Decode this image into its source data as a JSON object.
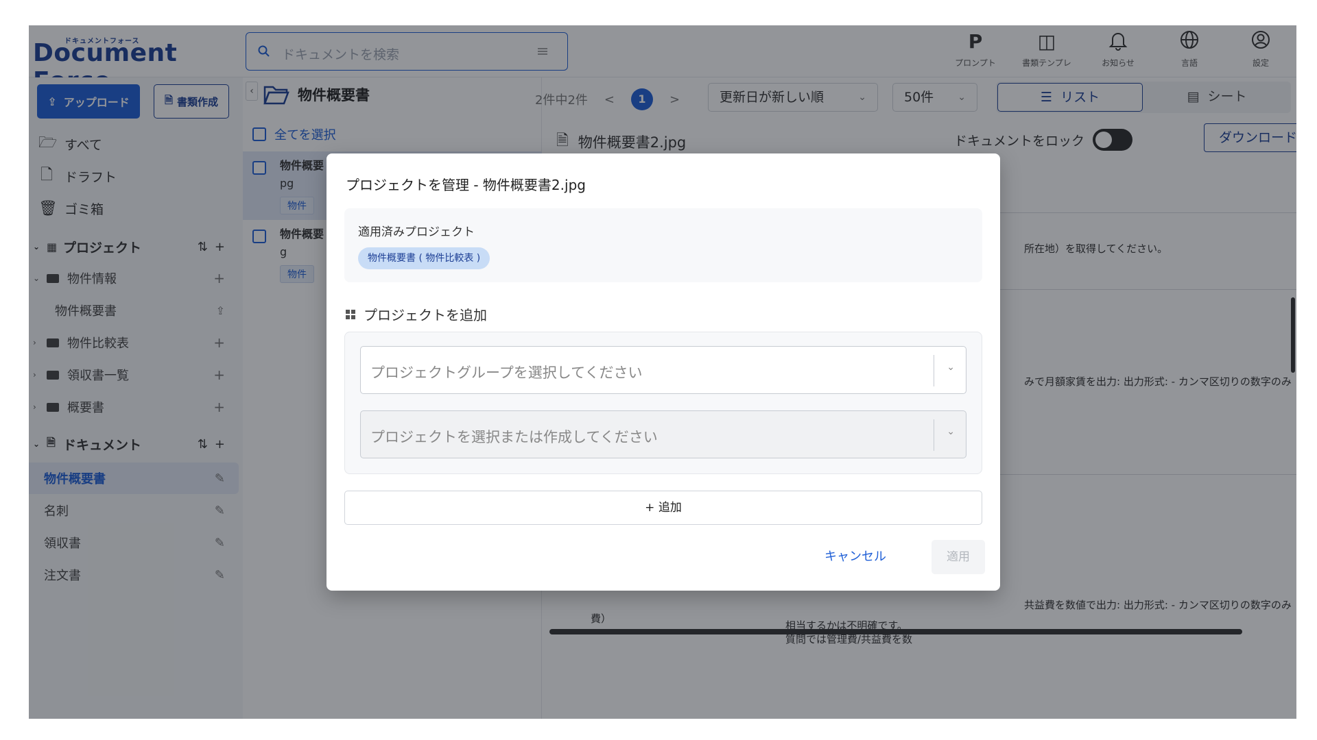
{
  "header": {
    "logo_kana": "ドキュメントフォース",
    "logo_text": "Document Force",
    "search_placeholder": "ドキュメントを検索",
    "icons": [
      {
        "glyph": "P",
        "label": "プロンプト",
        "icon": "prompt-icon"
      },
      {
        "glyph": "◫",
        "label": "書類テンプレ",
        "icon": "template-icon"
      },
      {
        "glyph": "🔔",
        "label": "お知らせ",
        "icon": "bell-icon"
      },
      {
        "glyph": "🌐",
        "label": "言語",
        "icon": "globe-icon"
      },
      {
        "glyph": "◉",
        "label": "設定",
        "icon": "settings-icon"
      }
    ]
  },
  "sidebar": {
    "upload_label": "アップロード",
    "create_label": "書類作成",
    "nav": [
      {
        "label": "すべて",
        "icon": "folder-open-icon"
      },
      {
        "label": "ドラフト",
        "icon": "file-icon"
      },
      {
        "label": "ゴミ箱",
        "icon": "trash-icon"
      }
    ],
    "projects_header": "プロジェクト",
    "project_tree": [
      {
        "label": "物件情報",
        "expanded": true
      },
      {
        "label": "物件概要書",
        "child": true
      },
      {
        "label": "物件比較表",
        "expanded": false
      },
      {
        "label": "領収書一覧",
        "expanded": false
      },
      {
        "label": "概要書",
        "expanded": false
      }
    ],
    "documents_header": "ドキュメント",
    "documents": [
      {
        "label": "物件概要書",
        "active": true
      },
      {
        "label": "名刺",
        "active": false
      },
      {
        "label": "領収書",
        "active": false
      },
      {
        "label": "注文書",
        "active": false
      }
    ]
  },
  "list": {
    "title": "物件概要書",
    "select_all": "全てを選択",
    "cards": [
      {
        "name_line1": "物件概要",
        "name_line2": "pg",
        "tag": "物件"
      },
      {
        "name_line1": "物件概要",
        "name_line2": "g",
        "tag": "物件"
      }
    ]
  },
  "toolbar": {
    "count": "2件中2件",
    "prev": "<",
    "page": "1",
    "next": ">",
    "sort": "更新日が新しい順",
    "per_page": "50件",
    "view_list": "リスト",
    "view_sheet": "シート"
  },
  "detail": {
    "filename": "物件概要書2.jpg",
    "lock_label": "ドキュメントをロック",
    "download_label": "ダウンロード",
    "text1": "所在地）を取得してください。",
    "text2": "みで月額家賃を出力: 出力形式: - カンマ区切りの数字のみ（例",
    "text3": "共益費を数値で出力: 出力形式: - カンマ区切りの数字のみ（例",
    "text4": "費）",
    "text5": "相当するかは不明確です。",
    "text6": "質問では管理費/共益費を数"
  },
  "modal": {
    "title": "プロジェクトを管理 - 物件概要書2.jpg",
    "applied_label": "適用済みプロジェクト",
    "applied_chip": "物件概要書 ( 物件比較表 )",
    "add_header": "プロジェクトを追加",
    "group_placeholder": "プロジェクトグループを選択してください",
    "project_placeholder": "プロジェクトを選択または作成してください",
    "add_button": "+ 追加",
    "cancel_button": "キャンセル",
    "apply_button": "適用"
  }
}
